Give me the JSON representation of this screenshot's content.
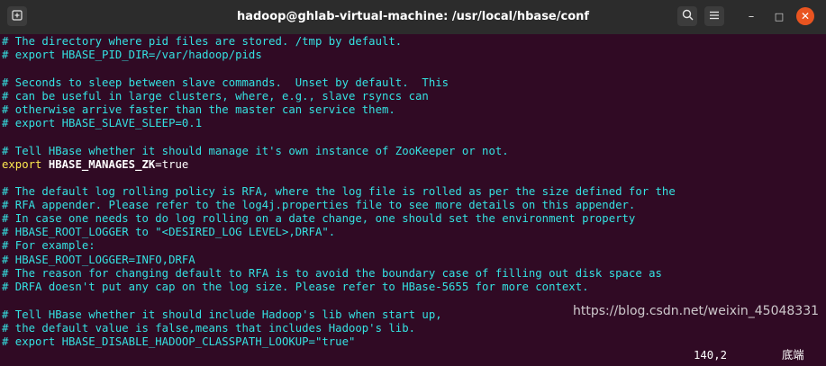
{
  "titlebar": {
    "title": "hadoop@ghlab-virtual-machine: /usr/local/hbase/conf",
    "new_tab_icon": "new-tab-icon",
    "search_icon": "search-icon",
    "menu_icon": "hamburger-menu-icon",
    "minimize_glyph": "–",
    "maximize_glyph": "□",
    "close_glyph": "✕"
  },
  "terminal": {
    "lines": [
      "# The directory where pid files are stored. /tmp by default.",
      "# export HBASE_PID_DIR=/var/hadoop/pids",
      "",
      "# Seconds to sleep between slave commands.  Unset by default.  This",
      "# can be useful in large clusters, where, e.g., slave rsyncs can",
      "# otherwise arrive faster than the master can service them.",
      "# export HBASE_SLAVE_SLEEP=0.1",
      "",
      "# Tell HBase whether it should manage it's own instance of ZooKeeper or not.",
      "",
      "",
      "# The default log rolling policy is RFA, where the log file is rolled as per the size defined for the",
      "# RFA appender. Please refer to the log4j.properties file to see more details on this appender.",
      "# In case one needs to do log rolling on a date change, one should set the environment property",
      "# HBASE_ROOT_LOGGER to \"<DESIRED_LOG LEVEL>,DRFA\".",
      "# For example:",
      "# HBASE_ROOT_LOGGER=INFO,DRFA",
      "# The reason for changing default to RFA is to avoid the boundary case of filling out disk space as",
      "# DRFA doesn't put any cap on the log size. Please refer to HBase-5655 for more context.",
      "",
      "# Tell HBase whether it should include Hadoop's lib when start up,",
      "# the default value is false,means that includes Hadoop's lib.",
      "# export HBASE_DISABLE_HADOOP_CLASSPATH_LOOKUP=\"true\""
    ],
    "export_line": {
      "keyword": "export",
      "variable": "HBASE_MANAGES_ZK",
      "value": "=true"
    },
    "status_position": "140,2",
    "status_location": "底端"
  },
  "watermark": "https://blog.csdn.net/weixin_45048331",
  "colors": {
    "background": "#300a24",
    "comment": "#34e2e2",
    "keyword": "#fce94f",
    "text": "#ffffff",
    "close_button": "#e95420"
  }
}
